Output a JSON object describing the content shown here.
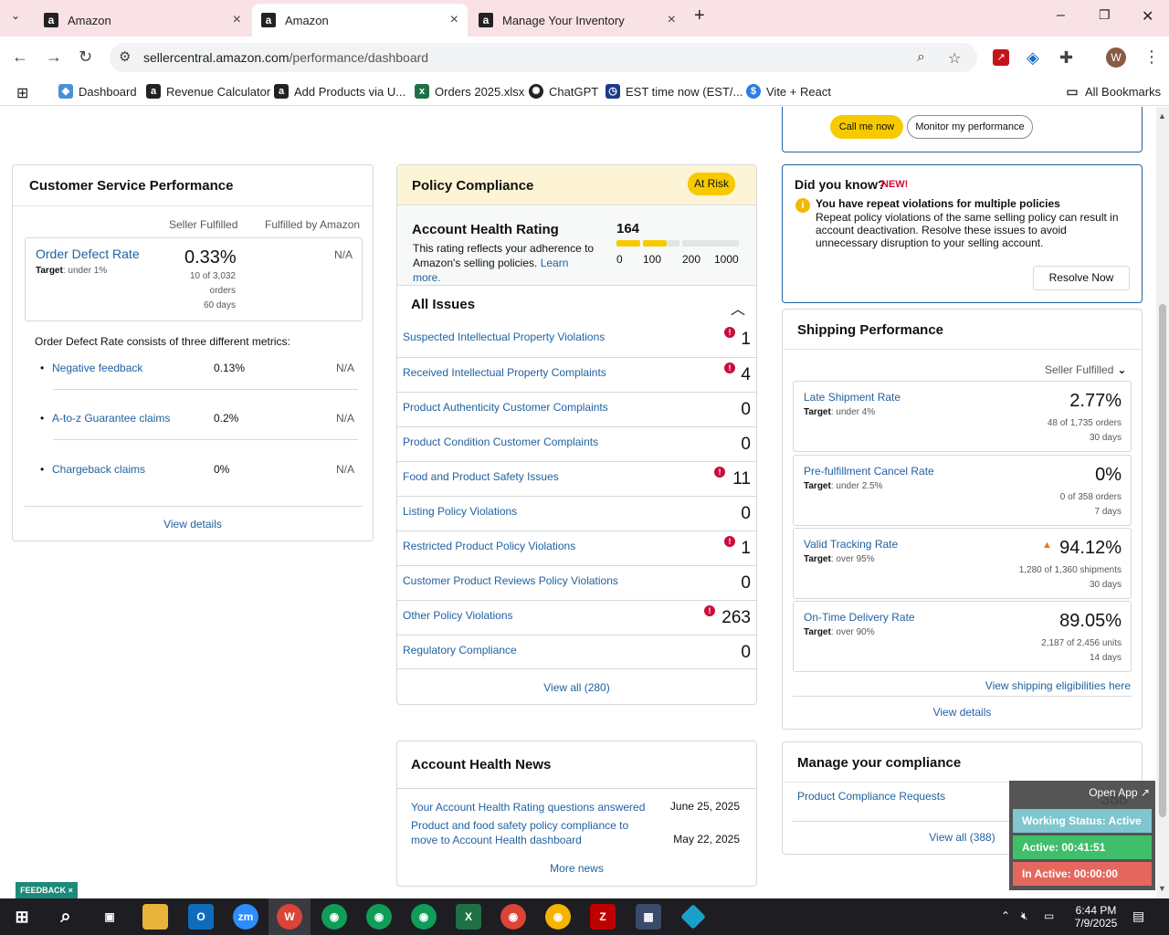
{
  "browser": {
    "tabs": [
      {
        "title": "Amazon",
        "icon": "amazon-icon"
      },
      {
        "title": "Amazon",
        "icon": "amazon-icon"
      },
      {
        "title": "Manage Your Inventory",
        "icon": "amazon-icon"
      }
    ],
    "url_domain": "sellercentral.amazon.com",
    "url_path": "/performance/dashboard",
    "profile_initial": "W",
    "bookmarks": [
      "Dashboard",
      "Revenue Calculator",
      "Add Products via U...",
      "Orders 2025.xlsx",
      "ChatGPT",
      "EST time now (EST/...",
      "Vite + React"
    ],
    "all_bookmarks": "All Bookmarks"
  },
  "top_buttons": {
    "call": "Call me now",
    "monitor": "Monitor my performance"
  },
  "customer_service": {
    "title": "Customer Service Performance",
    "col_seller": "Seller Fulfilled",
    "col_amazon": "Fulfilled by Amazon",
    "odr": {
      "title": "Order Defect Rate",
      "target_label": "Target",
      "target_value": ": under 1%",
      "value": "0.33%",
      "na": "N/A",
      "sub1": "10 of 3,032",
      "sub2": "orders",
      "sub3": "60 days"
    },
    "intro": "Order Defect Rate consists of three different metrics:",
    "metrics": [
      {
        "label": "Negative feedback",
        "value": "0.13%",
        "na": "N/A"
      },
      {
        "label": "A-to-z Guarantee claims",
        "value": "0.2%",
        "na": "N/A"
      },
      {
        "label": "Chargeback claims",
        "value": "0%",
        "na": "N/A"
      }
    ],
    "view_details": "View details"
  },
  "policy": {
    "title": "Policy Compliance",
    "status": "At Risk",
    "ahr_title": "Account Health Rating",
    "ahr_desc": "This rating reflects your adherence to Amazon's selling policies.",
    "ahr_learn": "Learn more.",
    "score": "164",
    "score_value": 164,
    "ticks": [
      "0",
      "100",
      "200",
      "1000"
    ],
    "issues_title": "All Issues",
    "issues": [
      {
        "label": "Suspected Intellectual Property Violations",
        "count": "1",
        "alert": true
      },
      {
        "label": "Received Intellectual Property Complaints",
        "count": "4",
        "alert": true
      },
      {
        "label": "Product Authenticity Customer Complaints",
        "count": "0",
        "alert": false
      },
      {
        "label": "Product Condition Customer Complaints",
        "count": "0",
        "alert": false
      },
      {
        "label": "Food and Product Safety Issues",
        "count": "11",
        "alert": true
      },
      {
        "label": "Listing Policy Violations",
        "count": "0",
        "alert": false
      },
      {
        "label": "Restricted Product Policy Violations",
        "count": "1",
        "alert": true
      },
      {
        "label": "Customer Product Reviews Policy Violations",
        "count": "0",
        "alert": false
      },
      {
        "label": "Other Policy Violations",
        "count": "263",
        "alert": true
      },
      {
        "label": "Regulatory Compliance",
        "count": "0",
        "alert": false
      }
    ],
    "view_all": "View all (280)"
  },
  "news": {
    "title": "Account Health News",
    "items": [
      {
        "text": "Your Account Health Rating questions answered",
        "date": "June 25, 2025"
      },
      {
        "text": "Product and food safety policy compliance to move to Account Health dashboard",
        "date": "May 22, 2025"
      }
    ],
    "more": "More news"
  },
  "did_you_know": {
    "title": "Did you know?",
    "badge": "NEW!",
    "heading": "You have repeat violations for multiple policies",
    "body": "Repeat policy violations of the same selling policy can result in account deactivation. Resolve these issues to avoid unnecessary disruption to your selling account.",
    "button": "Resolve Now"
  },
  "shipping": {
    "title": "Shipping Performance",
    "filter": "Seller Fulfilled",
    "metrics": [
      {
        "title": "Late Shipment Rate",
        "target": ": under 4%",
        "value": "2.77%",
        "sub1": "48 of 1,735 orders",
        "sub2": "30 days",
        "warn": false
      },
      {
        "title": "Pre-fulfillment Cancel Rate",
        "target": ": under 2.5%",
        "value": "0%",
        "sub1": "0 of 358 orders",
        "sub2": "7 days",
        "warn": false
      },
      {
        "title": "Valid Tracking Rate",
        "target": ": over 95%",
        "value": "94.12%",
        "sub1": "1,280 of 1,360 shipments",
        "sub2": "30 days",
        "warn": true
      },
      {
        "title": "On-Time Delivery Rate",
        "target": ": over 90%",
        "value": "89.05%",
        "sub1": "2,187 of 2,456 units",
        "sub2": "14 days",
        "warn": false
      }
    ],
    "target_label": "Target",
    "eligibilities": "View shipping eligibilities here",
    "view_details": "View details"
  },
  "manage_compliance": {
    "title": "Manage your compliance",
    "item": "Product Compliance Requests",
    "count": "388",
    "view_all": "View all (388)"
  },
  "widget": {
    "open": "Open App ↗",
    "status": "Working Status: Active",
    "active": "Active: 00:41:51",
    "inactive": "In Active: 00:00:00"
  },
  "feedback": "FEEDBACK ×",
  "taskbar": {
    "time": "6:44 PM",
    "date": "7/9/2025"
  },
  "colors": {
    "accent_link": "#2162a1",
    "yellow": "#f7ca00",
    "alert_red": "#cc0c39",
    "widget_teal": "#5cb8c4",
    "widget_green": "#3fbf6a",
    "widget_red": "#e5685f"
  }
}
